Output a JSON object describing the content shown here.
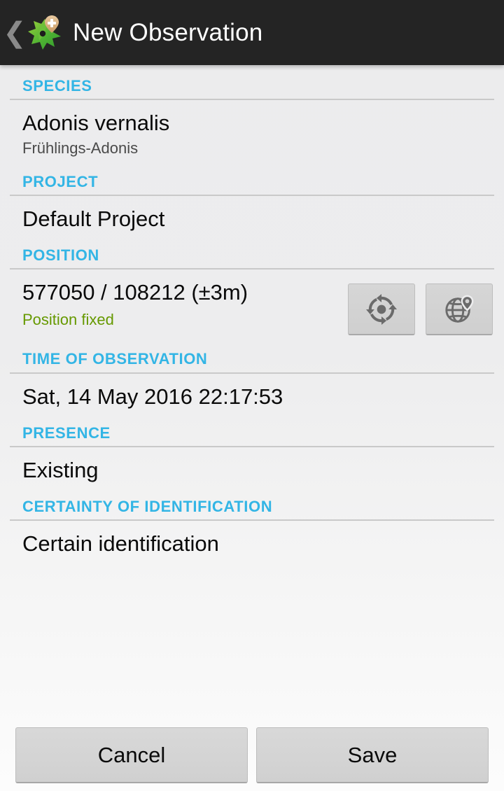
{
  "actionbar": {
    "back_icon": "chevron-left-icon",
    "app_icon": "leaf-map-pin-plus-icon",
    "title": "New Observation"
  },
  "colors": {
    "accent": "#33b5e5",
    "status_ok": "#669900",
    "actionbar_bg": "#242424",
    "page_bg": "#ededee",
    "divider": "#c9c9c9",
    "button_bg": "#d4d4d4"
  },
  "sections": {
    "species": {
      "label": "SPECIES",
      "scientific_name": "Adonis vernalis",
      "common_name": "Frühlings-Adonis"
    },
    "project": {
      "label": "PROJECT",
      "value": "Default Project"
    },
    "position": {
      "label": "POSITION",
      "coordinates": "577050 / 108212 (±3m)",
      "status": "Position fixed",
      "buttons": [
        {
          "name": "gps-fix-button",
          "icon": "gps-target-refresh-icon"
        },
        {
          "name": "map-pick-button",
          "icon": "globe-map-pin-icon"
        }
      ]
    },
    "time": {
      "label": "TIME OF OBSERVATION",
      "value": "Sat, 14 May 2016 22:17:53"
    },
    "presence": {
      "label": "PRESENCE",
      "value": "Existing"
    },
    "certainty": {
      "label": "CERTAINTY OF IDENTIFICATION",
      "value": "Certain identification"
    }
  },
  "footer": {
    "cancel_label": "Cancel",
    "save_label": "Save"
  }
}
